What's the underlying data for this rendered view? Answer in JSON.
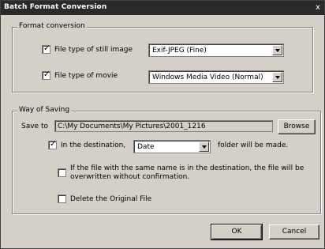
{
  "window": {
    "title": "Batch Format Conversion",
    "close_glyph": "x"
  },
  "format_conversion": {
    "group_label": "Format conversion",
    "still_image": {
      "checked": true,
      "label": "File type of still image",
      "value": "Exif-JPEG (Fine)"
    },
    "movie": {
      "checked": true,
      "label": "File type of movie",
      "value": "Windows Media Video (Normal)"
    }
  },
  "way_of_saving": {
    "group_label": "Way of Saving",
    "save_to_label": "Save to",
    "save_to_path": "C:\\My Documents\\My Pictures\\2001_1216",
    "browse_label": "Browse",
    "destination": {
      "checked": true,
      "label": "In the destination,",
      "value": "Date",
      "suffix": "folder will be made."
    },
    "overwrite": {
      "checked": false,
      "label": "If the file with the same name is in the destination, the file will be overwritten without confirmation."
    },
    "delete_original": {
      "checked": false,
      "label": "Delete the Original File"
    }
  },
  "buttons": {
    "ok_label": "OK",
    "cancel_label": "Cancel"
  },
  "colors": {
    "face": "#d4d0c8",
    "titlebar": "#2a2a2a"
  },
  "icons": {
    "close": "close-icon",
    "combo_arrow": "chevron-down-icon",
    "check": "checkmark-icon"
  }
}
